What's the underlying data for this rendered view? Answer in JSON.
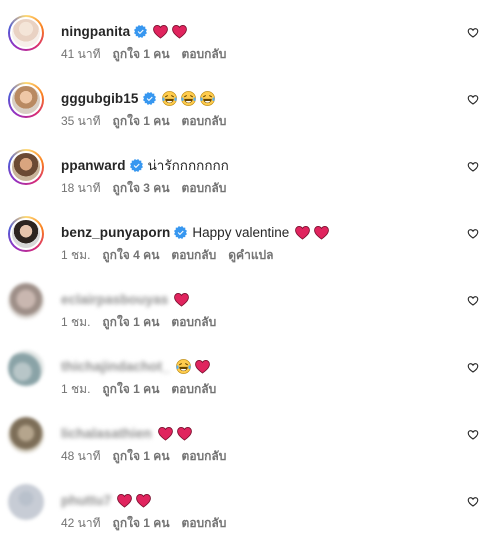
{
  "comments": [
    {
      "username": "ningpanita",
      "verified": true,
      "text": "",
      "emoji": [
        "red-heart",
        "red-heart"
      ],
      "time": "41 นาที",
      "likes": "ถูกใจ 1 คน",
      "reply": "ตอบกลับ",
      "translate": ""
    },
    {
      "username": "gggubgib15",
      "verified": true,
      "text": "",
      "emoji": [
        "laughing-tears",
        "laughing-tears",
        "laughing-tears"
      ],
      "time": "35 นาที",
      "likes": "ถูกใจ 1 คน",
      "reply": "ตอบกลับ",
      "translate": ""
    },
    {
      "username": "ppanward",
      "verified": true,
      "text": "น่ารักกกกกกก",
      "emoji": [],
      "time": "18 นาที",
      "likes": "ถูกใจ 3 คน",
      "reply": "ตอบกลับ",
      "translate": ""
    },
    {
      "username": "benz_punyaporn",
      "verified": true,
      "text": "Happy valentine",
      "emoji": [
        "red-heart",
        "red-heart"
      ],
      "time": "1 ชม.",
      "likes": "ถูกใจ 4 คน",
      "reply": "ตอบกลับ",
      "translate": "ดูคำแปล"
    },
    {
      "username": "eclairpasbouyas",
      "verified": false,
      "text": "",
      "emoji": [
        "red-heart"
      ],
      "time": "1 ชม.",
      "likes": "ถูกใจ 1 คน",
      "reply": "ตอบกลับ",
      "translate": ""
    },
    {
      "username": "thichajindachot_",
      "verified": false,
      "text": "",
      "emoji": [
        "laughing-tears",
        "red-heart"
      ],
      "time": "1 ชม.",
      "likes": "ถูกใจ 1 คน",
      "reply": "ตอบกลับ",
      "translate": ""
    },
    {
      "username": "lichalasathien",
      "verified": false,
      "text": "",
      "emoji": [
        "red-heart",
        "red-heart"
      ],
      "time": "48 นาที",
      "likes": "ถูกใจ 1 คน",
      "reply": "ตอบกลับ",
      "translate": ""
    },
    {
      "username": "phuttu7",
      "verified": false,
      "text": "",
      "emoji": [
        "red-heart",
        "red-heart"
      ],
      "time": "42 นาที",
      "likes": "ถูกใจ 1 คน",
      "reply": "ตอบกลับ",
      "translate": ""
    }
  ],
  "colors": {
    "verified": "#3797f0",
    "heart": "#e0245e",
    "meta": "#737373",
    "ring": "#d62976"
  }
}
